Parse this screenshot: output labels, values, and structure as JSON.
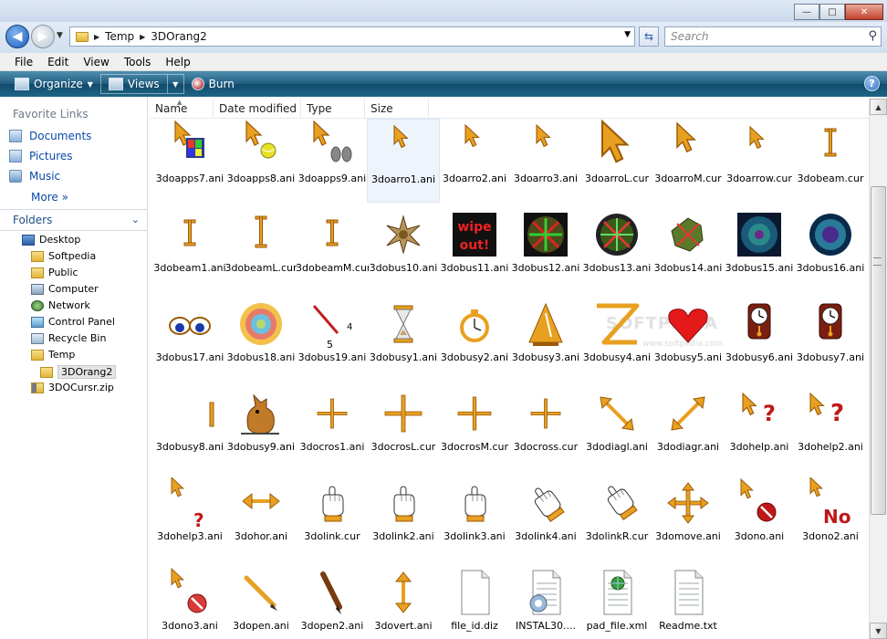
{
  "window": {
    "minimize_glyph": "—",
    "maximize_glyph": "□",
    "close_glyph": "✕"
  },
  "address": {
    "crumbs": [
      "Temp",
      "3DOrang2"
    ],
    "search_placeholder": "Search"
  },
  "menu": [
    "File",
    "Edit",
    "View",
    "Tools",
    "Help"
  ],
  "commands": {
    "organize": "Organize",
    "views": "Views",
    "burn": "Burn"
  },
  "nav": {
    "favorites_title": "Favorite Links",
    "favorites": [
      "Documents",
      "Pictures",
      "Music"
    ],
    "more": "More",
    "folders_title": "Folders",
    "tree": [
      {
        "label": "Desktop",
        "icon": "desktop-icon",
        "indent": 0
      },
      {
        "label": "Softpedia",
        "icon": "folder-icon",
        "indent": 1
      },
      {
        "label": "Public",
        "icon": "folder-icon",
        "indent": 1
      },
      {
        "label": "Computer",
        "icon": "computer-icon",
        "indent": 1
      },
      {
        "label": "Network",
        "icon": "network-icon",
        "indent": 1
      },
      {
        "label": "Control Panel",
        "icon": "control-panel-icon",
        "indent": 1
      },
      {
        "label": "Recycle Bin",
        "icon": "recycle-bin-icon",
        "indent": 1
      },
      {
        "label": "Temp",
        "icon": "folder-icon",
        "indent": 1
      },
      {
        "label": "3DOrang2",
        "icon": "folder-icon",
        "indent": 2,
        "selected": true
      },
      {
        "label": "3DOCursr.zip",
        "icon": "zip-folder-icon",
        "indent": 1
      }
    ]
  },
  "columns": [
    "Name",
    "Date modified",
    "Type",
    "Size"
  ],
  "files": [
    [
      "3doapps7.ani",
      "3doapps8.ani",
      "3doapps9.ani",
      "3doarro1.ani",
      "3doarro2.ani",
      "3doarro3.ani",
      "3doarroL.cur",
      "3doarroM.cur",
      "3doarrow.cur",
      "3dobeam.cur"
    ],
    [
      "3dobeam1.ani",
      "3dobeamL.cur",
      "3dobeamM.cur",
      "3dobus10.ani",
      "3dobus11.ani",
      "3dobus12.ani",
      "3dobus13.ani",
      "3dobus14.ani",
      "3dobus15.ani",
      "3dobus16.ani"
    ],
    [
      "3dobus17.ani",
      "3dobus18.ani",
      "3dobus19.ani",
      "3dobusy1.ani",
      "3dobusy2.ani",
      "3dobusy3.ani",
      "3dobusy4.ani",
      "3dobusy5.ani",
      "3dobusy6.ani",
      "3dobusy7.ani"
    ],
    [
      "3dobusy8.ani",
      "3dobusy9.ani",
      "3docros1.ani",
      "3docrosL.cur",
      "3docrosM.cur",
      "3docross.cur",
      "3dodiagl.ani",
      "3dodiagr.ani",
      "3dohelp.ani",
      "3dohelp2.ani"
    ],
    [
      "3dohelp3.ani",
      "3dohor.ani",
      "3dolink.cur",
      "3dolink2.ani",
      "3dolink3.ani",
      "3dolink4.ani",
      "3dolinkR.cur",
      "3domove.ani",
      "3dono.ani",
      "3dono2.ani"
    ],
    [
      "3dono3.ani",
      "3dopen.ani",
      "3dopen2.ani",
      "3dovert.ani",
      "file_id.diz",
      "INSTAL30....",
      "pad_file.xml",
      "Readme.txt"
    ]
  ],
  "icon_text": {
    "wipe": "wipe",
    "out": "out!",
    "no": "No",
    "q": "?",
    "five": "5",
    "four": "4"
  },
  "watermark": "SOFTPEDIA",
  "watermark_url": "www.softpedia.com",
  "selected_file": "3doarro1.ani",
  "colors": {
    "accent": "#e8a020",
    "link": "#0a4aa8",
    "cmdbar": "#1f5d7e"
  }
}
